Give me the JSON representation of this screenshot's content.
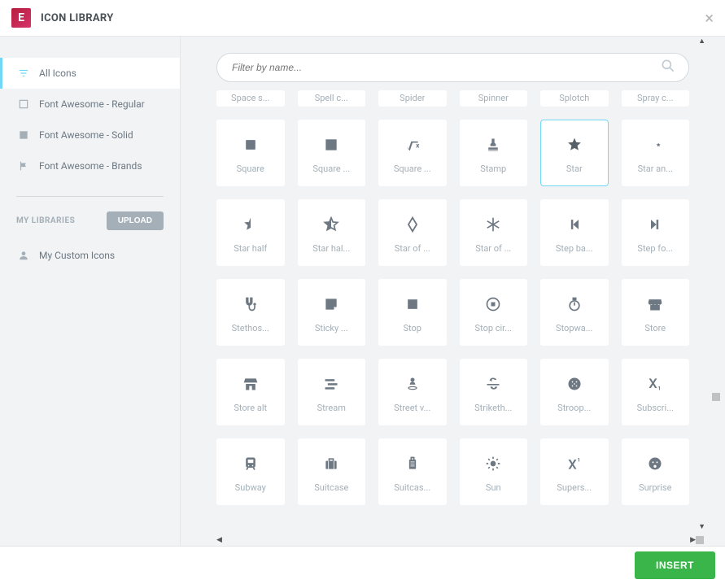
{
  "header": {
    "title": "ICON LIBRARY"
  },
  "sidebar": {
    "items": [
      {
        "label": "All Icons",
        "icon": "filter"
      },
      {
        "label": "Font Awesome - Regular",
        "icon": "square-o"
      },
      {
        "label": "Font Awesome - Solid",
        "icon": "square"
      },
      {
        "label": "Font Awesome - Brands",
        "icon": "flag"
      }
    ],
    "section": "MY LIBRARIES",
    "upload": "UPLOAD",
    "custom": "My Custom Icons"
  },
  "search": {
    "placeholder": "Filter by name..."
  },
  "partial_row": [
    "Space s...",
    "Spell c...",
    "Spider",
    "Spinner",
    "Splotch",
    "Spray c..."
  ],
  "icons": [
    {
      "label": "Square",
      "glyph": "square"
    },
    {
      "label": "Square ...",
      "glyph": "square-full"
    },
    {
      "label": "Square ...",
      "glyph": "square-root"
    },
    {
      "label": "Stamp",
      "glyph": "stamp"
    },
    {
      "label": "Star",
      "glyph": "star",
      "selected": true
    },
    {
      "label": "Star an...",
      "glyph": "star-crescent"
    },
    {
      "label": "Star half",
      "glyph": "star-half"
    },
    {
      "label": "Star hal...",
      "glyph": "star-half-o"
    },
    {
      "label": "Star of ...",
      "glyph": "star-david"
    },
    {
      "label": "Star of ...",
      "glyph": "star-life"
    },
    {
      "label": "Step ba...",
      "glyph": "step-back"
    },
    {
      "label": "Step fo...",
      "glyph": "step-forward"
    },
    {
      "label": "Stethos...",
      "glyph": "stethoscope"
    },
    {
      "label": "Sticky ...",
      "glyph": "sticky"
    },
    {
      "label": "Stop",
      "glyph": "stop"
    },
    {
      "label": "Stop cir...",
      "glyph": "stop-circle"
    },
    {
      "label": "Stopwa...",
      "glyph": "stopwatch"
    },
    {
      "label": "Store",
      "glyph": "store"
    },
    {
      "label": "Store alt",
      "glyph": "store-alt"
    },
    {
      "label": "Stream",
      "glyph": "stream"
    },
    {
      "label": "Street v...",
      "glyph": "street"
    },
    {
      "label": "Striketh...",
      "glyph": "strike"
    },
    {
      "label": "Stroop...",
      "glyph": "stroop"
    },
    {
      "label": "Subscri...",
      "glyph": "subscript"
    },
    {
      "label": "Subway",
      "glyph": "subway"
    },
    {
      "label": "Suitcase",
      "glyph": "suitcase"
    },
    {
      "label": "Suitcas...",
      "glyph": "suitcase-roll"
    },
    {
      "label": "Sun",
      "glyph": "sun"
    },
    {
      "label": "Supers...",
      "glyph": "superscript"
    },
    {
      "label": "Surprise",
      "glyph": "surprise"
    }
  ],
  "footer": {
    "insert": "INSERT"
  }
}
